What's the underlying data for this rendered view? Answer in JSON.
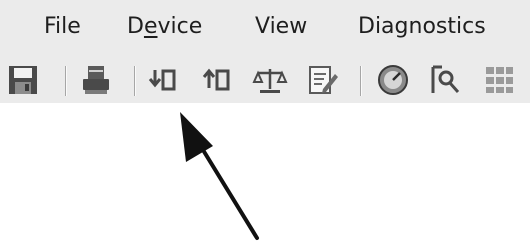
{
  "menubar": {
    "items": [
      {
        "label_pre": "File",
        "label_u": "",
        "label_post": ""
      },
      {
        "label_pre": "D",
        "label_u": "e",
        "label_post": "vice"
      },
      {
        "label_pre": "View",
        "label_u": "",
        "label_post": ""
      },
      {
        "label_pre": "Diagnostics",
        "label_u": "",
        "label_post": ""
      }
    ]
  },
  "toolbar": {
    "buttons": [
      {
        "icon": "save-icon"
      },
      {
        "icon": "print-icon"
      },
      {
        "icon": "download-to-device-icon"
      },
      {
        "icon": "upload-from-device-icon"
      },
      {
        "icon": "compare-scales-icon"
      },
      {
        "icon": "edit-document-icon"
      },
      {
        "icon": "gauge-icon"
      },
      {
        "icon": "search-document-icon"
      },
      {
        "icon": "grid-icon"
      }
    ]
  },
  "annotation": {
    "icon": "pointer-arrow-icon"
  }
}
